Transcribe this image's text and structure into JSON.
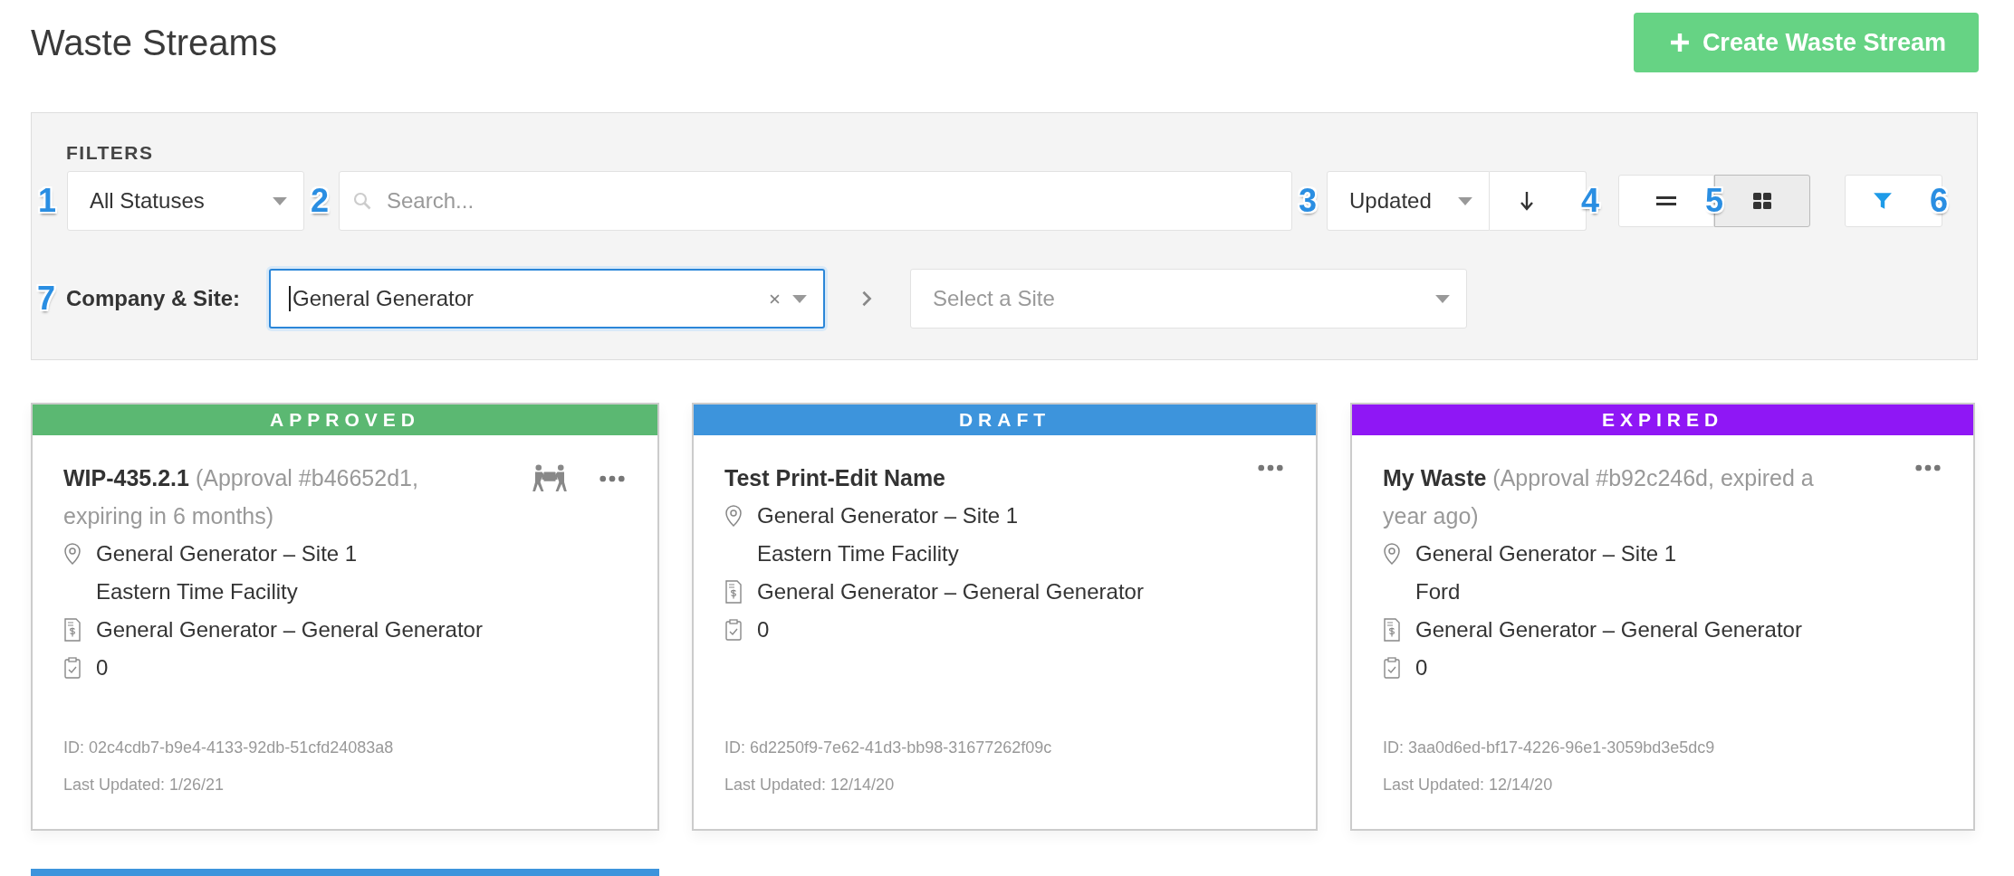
{
  "page": {
    "title": "Waste Streams"
  },
  "create_button": {
    "label": "Create Waste Stream"
  },
  "filters": {
    "heading": "FILTERS",
    "status_select": {
      "value": "All Statuses",
      "callout": "1"
    },
    "search": {
      "placeholder": "Search...",
      "callout": "2"
    },
    "sort_select": {
      "value": "Updated",
      "callout": "3"
    },
    "sort_direction": {
      "callout": "4"
    },
    "view_toggle": {
      "callout": "5",
      "options": [
        {
          "kind": "list",
          "selected": false
        },
        {
          "kind": "grid",
          "selected": true
        }
      ]
    },
    "filter_button": {
      "callout": "6"
    },
    "company_site": {
      "label": "Company & Site:",
      "callout": "7",
      "company": {
        "value": "General Generator",
        "focused": true
      },
      "site": {
        "placeholder": "Select a Site"
      }
    }
  },
  "cards": [
    {
      "status": "APPROVED",
      "color": "#5bb872",
      "name": "WIP-435.2.1",
      "approval": "(Approval #b46652d1, expiring in 6 months)",
      "pickup": true,
      "site": "General Generator – Site 1",
      "facility": "Eastern Time Facility",
      "billing": "General Generator – General Generator",
      "tasks": "0",
      "id": "ID: 02c4cdb7-b9e4-4133-92db-51cfd24083a8",
      "updated": "Last Updated: 1/26/21"
    },
    {
      "status": "DRAFT",
      "color": "#3d94dc",
      "name": "Test Print-Edit Name",
      "pickup": false,
      "site": "General Generator – Site 1",
      "facility": "Eastern Time Facility",
      "billing": "General Generator – General Generator",
      "tasks": "0",
      "id": "ID: 6d2250f9-7e62-41d3-bb98-31677262f09c",
      "updated": "Last Updated: 12/14/20"
    },
    {
      "status": "EXPIRED",
      "color": "#8f17f5",
      "name": "My Waste",
      "approval": "(Approval #b92c246d, expired a year ago)",
      "pickup": false,
      "site": "General Generator – Site 1",
      "facility": "Ford",
      "billing": "General Generator – General Generator",
      "tasks": "0",
      "id": "ID: 3aa0d6ed-bf17-4226-96e1-3059bd3e5dc9",
      "updated": "Last Updated: 12/14/20"
    }
  ],
  "next_card": {
    "color": "#3d94dc"
  }
}
